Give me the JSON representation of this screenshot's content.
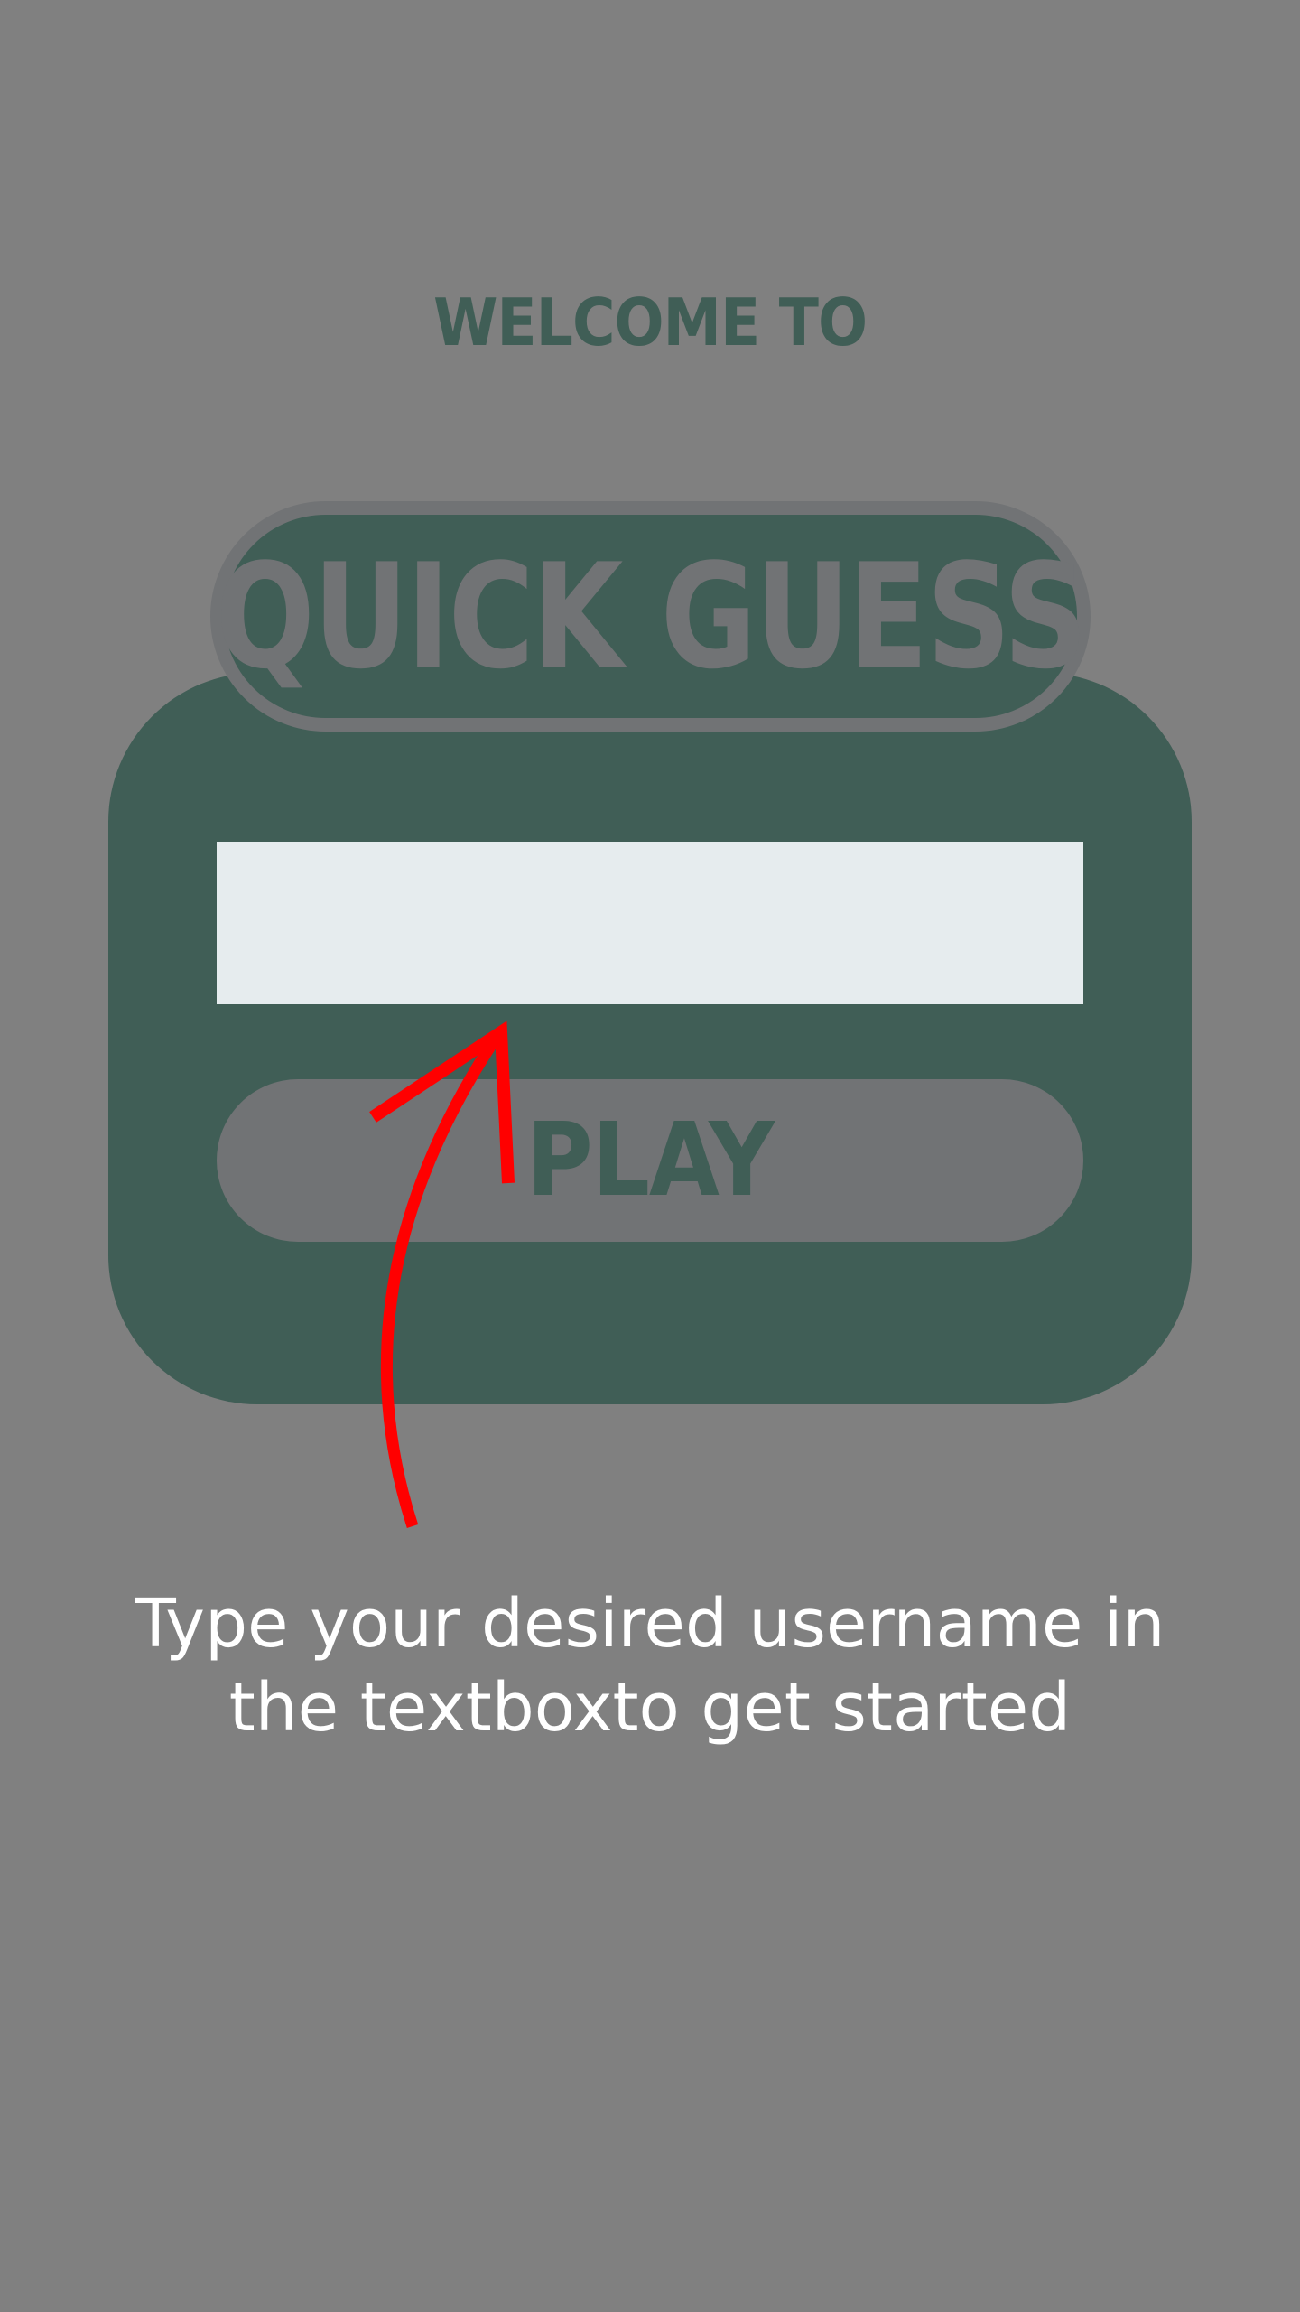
{
  "welcome": {
    "text": "WELCOME TO"
  },
  "title": {
    "text": "QUICK GUESS"
  },
  "form": {
    "username_value": "",
    "play_label": "PLAY"
  },
  "tutorial": {
    "line1": "Type your desired username in",
    "line2": "the textboxto get started"
  },
  "colors": {
    "background": "#808080",
    "card": "#405e56",
    "accent_gray": "#717375",
    "input_bg": "#e6ecee",
    "arrow": "#ff0000",
    "hint_text": "#ffffff"
  },
  "icons": {
    "arrow": "curved-up-arrow-icon"
  }
}
